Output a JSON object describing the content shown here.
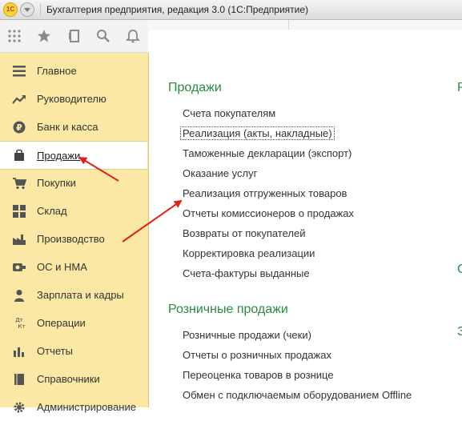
{
  "window": {
    "logo_text": "1С",
    "title": "Бухгалтерия предприятия, редакция 3.0  (1С:Предприятие)"
  },
  "toolbar": {
    "icons": [
      "apps-grid-icon",
      "star-icon",
      "history-icon",
      "search-icon",
      "bell-icon"
    ]
  },
  "sidebar": {
    "items": [
      {
        "label": "Главное",
        "icon": "menu-lines-icon"
      },
      {
        "label": "Руководителю",
        "icon": "trend-icon"
      },
      {
        "label": "Банк и касса",
        "icon": "ruble-icon"
      },
      {
        "label": "Продажи",
        "icon": "shopping-bag-icon",
        "active": true
      },
      {
        "label": "Покупки",
        "icon": "cart-icon"
      },
      {
        "label": "Склад",
        "icon": "warehouse-grid-icon"
      },
      {
        "label": "Производство",
        "icon": "factory-icon"
      },
      {
        "label": "ОС и НМА",
        "icon": "asset-icon"
      },
      {
        "label": "Зарплата и кадры",
        "icon": "person-icon"
      },
      {
        "label": "Операции",
        "icon": "dt-kt-icon"
      },
      {
        "label": "Отчеты",
        "icon": "bar-chart-icon"
      },
      {
        "label": "Справочники",
        "icon": "book-icon"
      },
      {
        "label": "Администрирование",
        "icon": "gear-icon"
      }
    ],
    "dt_label": "Дт",
    "kt_label": "Кт"
  },
  "main": {
    "sales": {
      "title": "Продажи",
      "links": [
        "Счета покупателям",
        "Реализация (акты, накладные)",
        "Таможенные декларации (экспорт)",
        "Оказание услуг",
        "Реализация отгруженных товаров",
        "Отчеты комиссионеров о продажах",
        "Возвраты от покупателей",
        "Корректировка реализации",
        "Счета-фактуры выданные"
      ]
    },
    "retail": {
      "title": "Розничные продажи",
      "links": [
        "Розничные продажи (чеки)",
        "Отчеты о розничных продажах",
        "Переоценка товаров в рознице",
        "Обмен с подключаемым оборудованием Offline"
      ]
    },
    "cut_letters": [
      "Р",
      "С",
      "З"
    ]
  },
  "colors": {
    "sidebar_bg": "#fbe8a4",
    "section_title": "#2d8a3e",
    "arrow": "#e0201a"
  }
}
